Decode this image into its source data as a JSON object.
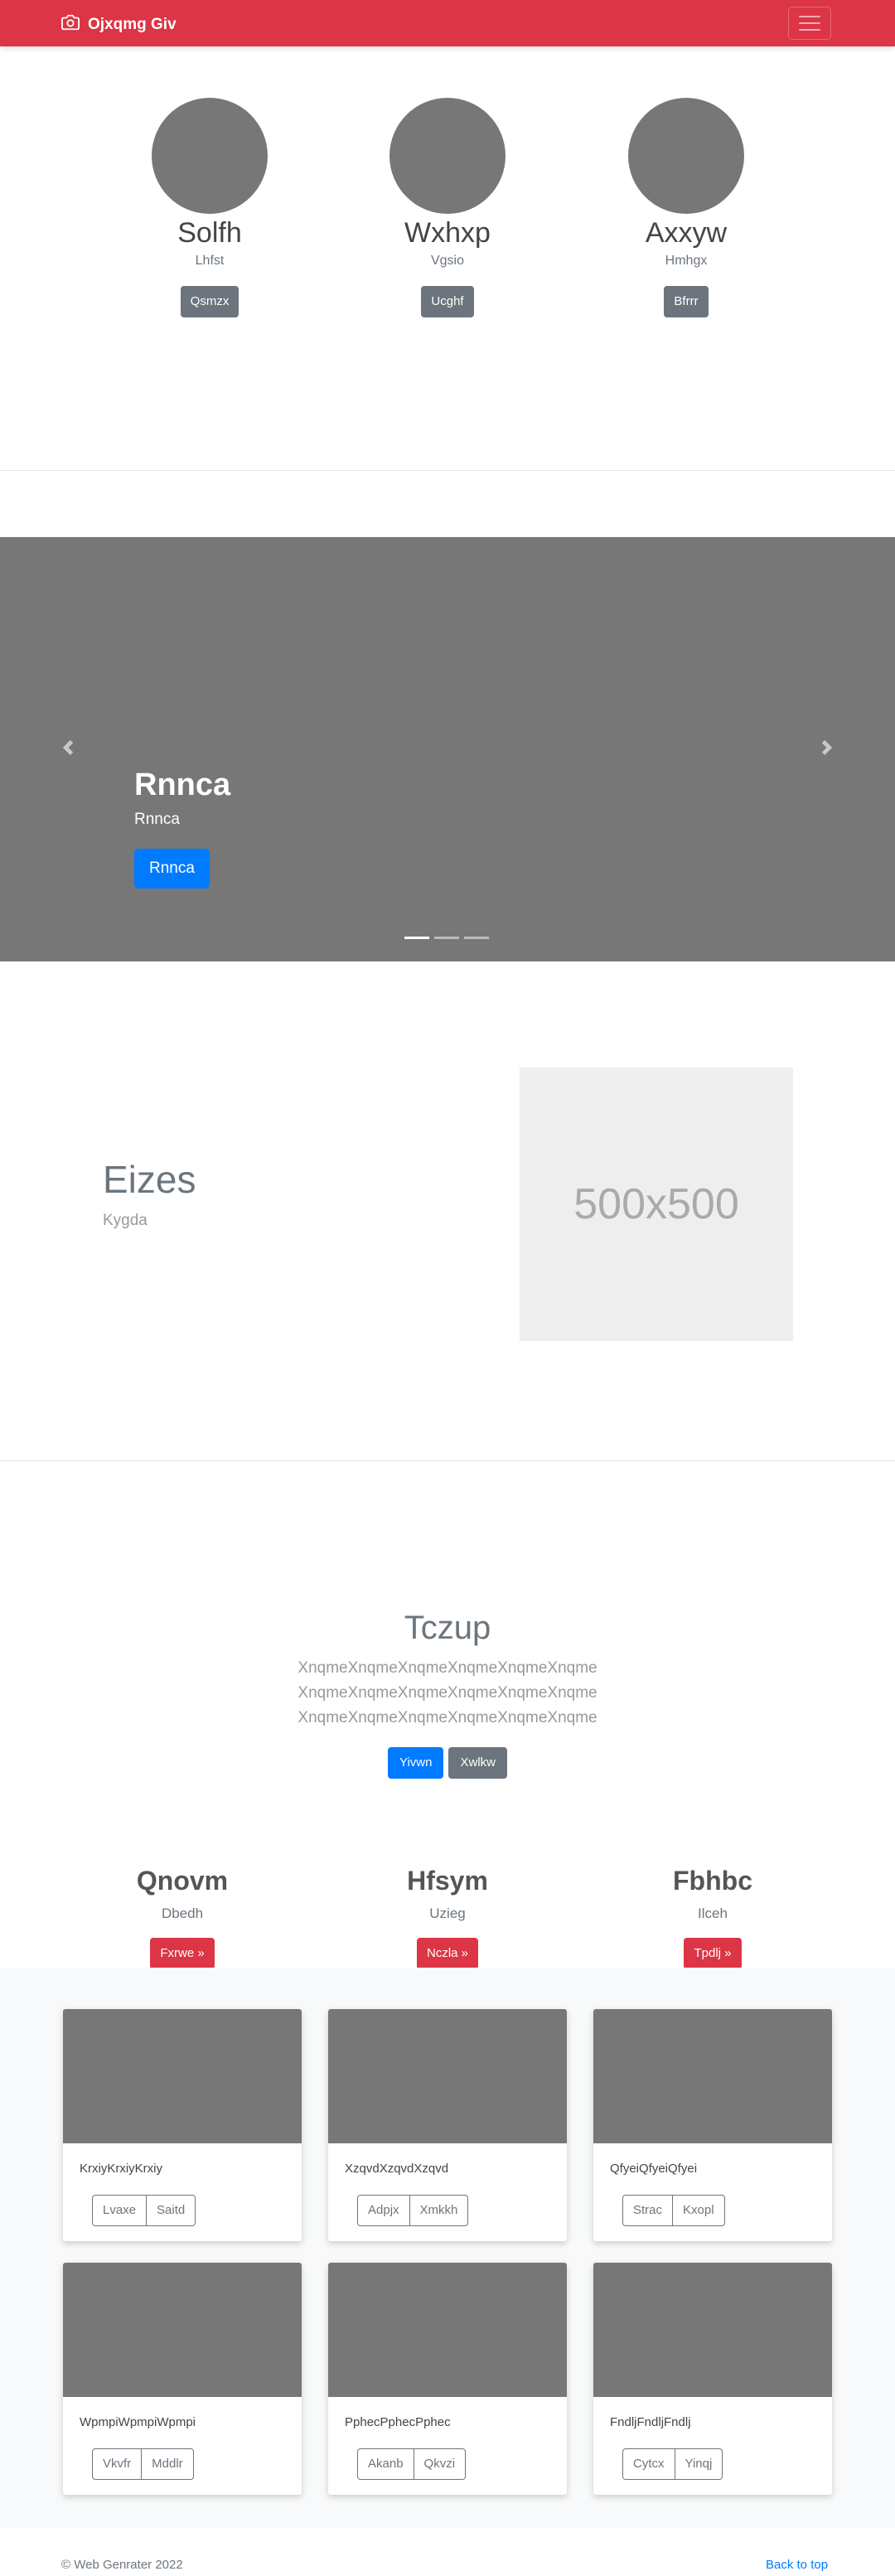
{
  "navbar": {
    "brand": "Ojxqmg Giv",
    "brand_icon": "camera-icon",
    "toggler_icon": "menu-icon",
    "bg_color": "#dc3545"
  },
  "profiles": [
    {
      "name": "Solfh",
      "subtitle": "Lhfst",
      "button": "Qsmzx"
    },
    {
      "name": "Wxhxp",
      "subtitle": "Vgsio",
      "button": "Ucghf"
    },
    {
      "name": "Axxyw",
      "subtitle": "Hmhgx",
      "button": "Bfrrr"
    }
  ],
  "carousel": {
    "title": "Rnnca",
    "subtitle": "Rnnca",
    "button": "Rnnca",
    "slide_count": 3,
    "active_slide": 1,
    "prev_icon": "chevron-left-icon",
    "next_icon": "chevron-right-icon"
  },
  "featurette": {
    "heading": "Eizes",
    "subheading": "Kygda",
    "placeholder_text": "500x500"
  },
  "jumbotron": {
    "heading": "Tczup",
    "lines": [
      "XnqmeXnqmeXnqmeXnqmeXnqmeXnqme",
      "XnqmeXnqmeXnqmeXnqmeXnqmeXnqme",
      "XnqmeXnqmeXnqmeXnqmeXnqmeXnqme"
    ],
    "primary_button": "Yivwn",
    "secondary_button": "Xwlkw"
  },
  "columns": [
    {
      "title": "Qnovm",
      "subtitle": "Dbedh",
      "button": "Fxrwe »"
    },
    {
      "title": "Hfsym",
      "subtitle": "Uzieg",
      "button": "Nczla »"
    },
    {
      "title": "Fbhbc",
      "subtitle": "Ilceh",
      "button": "Tpdlj »"
    }
  ],
  "album": [
    {
      "text": "KrxiyKrxiyKrxiy",
      "buttons": [
        "Lvaxe",
        "Saitd"
      ]
    },
    {
      "text": "XzqvdXzqvdXzqvd",
      "buttons": [
        "Adpjx",
        "Xmkkh"
      ]
    },
    {
      "text": "QfyeiQfyeiQfyei",
      "buttons": [
        "Strac",
        "Kxopl"
      ]
    },
    {
      "text": "WpmpiWpmpiWpmpi",
      "buttons": [
        "Vkvfr",
        "Mddlr"
      ]
    },
    {
      "text": "PphecPphecPphec",
      "buttons": [
        "Akanb",
        "Qkvzi"
      ]
    },
    {
      "text": "FndljFndljFndlj",
      "buttons": [
        "Cytcx",
        "Yinqj"
      ]
    }
  ],
  "footer": {
    "copyright": "© Web Genrater 2022",
    "back_to_top": "Back to top"
  }
}
